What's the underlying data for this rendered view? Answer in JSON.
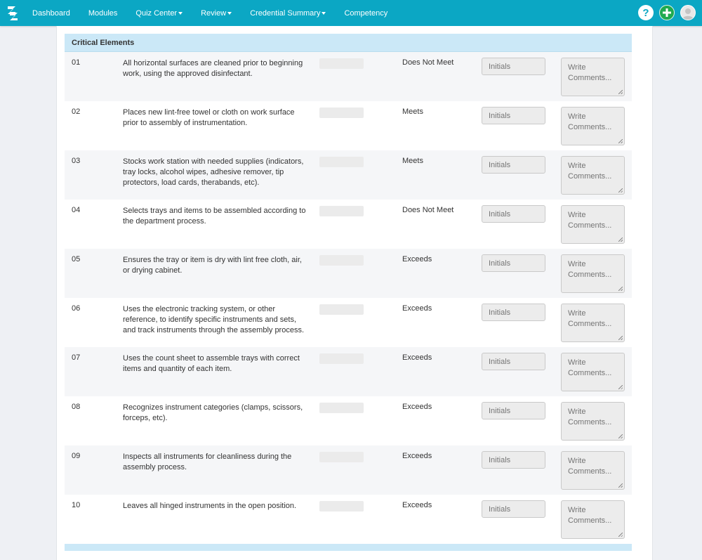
{
  "nav": {
    "items": [
      {
        "label": "Dashboard",
        "has_caret": false
      },
      {
        "label": "Modules",
        "has_caret": false
      },
      {
        "label": "Quiz Center",
        "has_caret": true
      },
      {
        "label": "Review",
        "has_caret": true
      },
      {
        "label": "Credential Summary",
        "has_caret": true
      },
      {
        "label": "Competency",
        "has_caret": false
      }
    ],
    "right_icons": [
      "help-icon",
      "add-icon",
      "user-avatar-icon"
    ],
    "bar_color": "#0ba7c4",
    "add_color": "#1faa4f"
  },
  "section": {
    "title": "Critical Elements",
    "header_color": "#cbe8f7"
  },
  "placeholders": {
    "initials": "Initials",
    "comments": "Write Comments..."
  },
  "rows": [
    {
      "num": "01",
      "desc": "All horizontal surfaces are cleaned prior to beginning work, using the approved disinfectant.",
      "rating": "Does Not Meet"
    },
    {
      "num": "02",
      "desc": "Places new lint-free towel or cloth on work surface prior to assembly of instrumentation.",
      "rating": "Meets"
    },
    {
      "num": "03",
      "desc": "Stocks work station with needed supplies (indicators, tray locks, alcohol wipes, adhesive remover, tip protectors, load cards, therabands, etc).",
      "rating": "Meets"
    },
    {
      "num": "04",
      "desc": "Selects trays and items to be assembled according to the department process.",
      "rating": "Does Not Meet"
    },
    {
      "num": "05",
      "desc": "Ensures the tray or item is dry with lint free cloth, air, or drying cabinet.",
      "rating": "Exceeds"
    },
    {
      "num": "06",
      "desc": "Uses the electronic tracking system, or other reference, to identify specific instruments and sets, and track instruments through the assembly process.",
      "rating": "Exceeds"
    },
    {
      "num": "07",
      "desc": "Uses the count sheet to assemble trays with correct items and quantity of each item.",
      "rating": "Exceeds"
    },
    {
      "num": "08",
      "desc": "Recognizes instrument categories (clamps, scissors, forceps, etc).",
      "rating": "Exceeds"
    },
    {
      "num": "09",
      "desc": "Inspects all instruments for cleanliness during the assembly process.",
      "rating": "Exceeds"
    },
    {
      "num": "10",
      "desc": "Leaves all hinged instruments in the open position.",
      "rating": "Exceeds"
    }
  ]
}
